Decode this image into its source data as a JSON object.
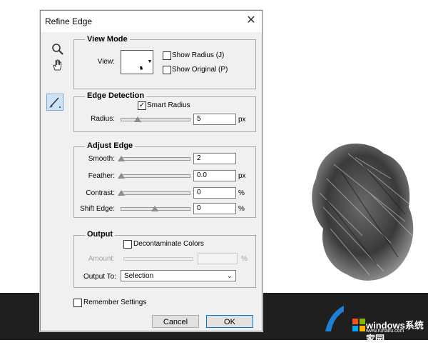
{
  "dialog": {
    "title": "Refine Edge",
    "close_glyph": "✕"
  },
  "tools": {
    "zoom_icon": "magnifier",
    "hand_icon": "hand",
    "brush_icon": "refine-radius-brush"
  },
  "view_mode": {
    "title": "View Mode",
    "view_label": "View:",
    "show_radius_label": "Show Radius (J)",
    "show_radius_checked": false,
    "show_original_label": "Show Original (P)",
    "show_original_checked": false
  },
  "edge_detection": {
    "title": "Edge Detection",
    "smart_radius_label": "Smart Radius",
    "smart_radius_checked": true,
    "radius_label": "Radius:",
    "radius_value": "5",
    "radius_unit": "px",
    "radius_slider_fraction": 0.25
  },
  "adjust_edge": {
    "title": "Adjust Edge",
    "rows": [
      {
        "label": "Smooth:",
        "value": "2",
        "unit": "",
        "slider_fraction": 0.0
      },
      {
        "label": "Feather:",
        "value": "0.0",
        "unit": "px",
        "slider_fraction": 0.0
      },
      {
        "label": "Contrast:",
        "value": "0",
        "unit": "%",
        "slider_fraction": 0.0
      },
      {
        "label": "Shift Edge:",
        "value": "0",
        "unit": "%",
        "slider_fraction": 0.5
      }
    ]
  },
  "output": {
    "title": "Output",
    "decontaminate_label": "Decontaminate Colors",
    "decontaminate_checked": false,
    "amount_label": "Amount:",
    "amount_value": "",
    "amount_unit": "%",
    "output_to_label": "Output To:",
    "output_to_value": "Selection"
  },
  "remember": {
    "label": "Remember Settings",
    "checked": false
  },
  "buttons": {
    "cancel": "Cancel",
    "ok": "OK"
  },
  "watermark": {
    "text": "windows系统家园",
    "url": "www.ruhaitu.com"
  },
  "colors": {
    "dialog_bg": "#f0f0f0",
    "accent": "#0078d7",
    "bottom_bar": "#1f1f1f"
  }
}
